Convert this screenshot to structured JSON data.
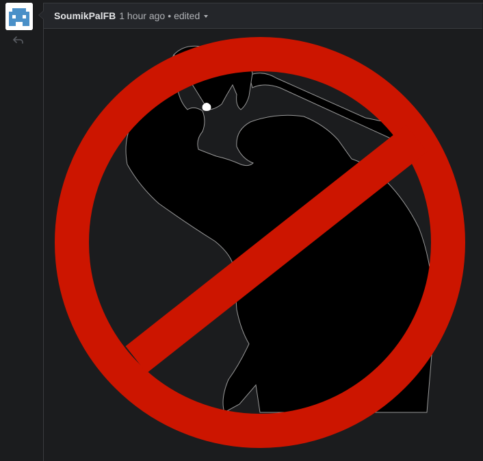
{
  "comment": {
    "author": "SoumikPalFB",
    "timestamp": "1 hour ago",
    "separator": "•",
    "edited_label": "edited"
  },
  "icons": {
    "avatar": "pixel-invader-avatar",
    "reply": "reply-arrow-icon",
    "edited_menu": "chevron-down-icon"
  },
  "colors": {
    "background": "#1b1c1e",
    "header_background": "#24262a",
    "prohibition_red": "#cc1500",
    "silhouette": "#000000",
    "avatar_blue": "#4a90c8"
  }
}
